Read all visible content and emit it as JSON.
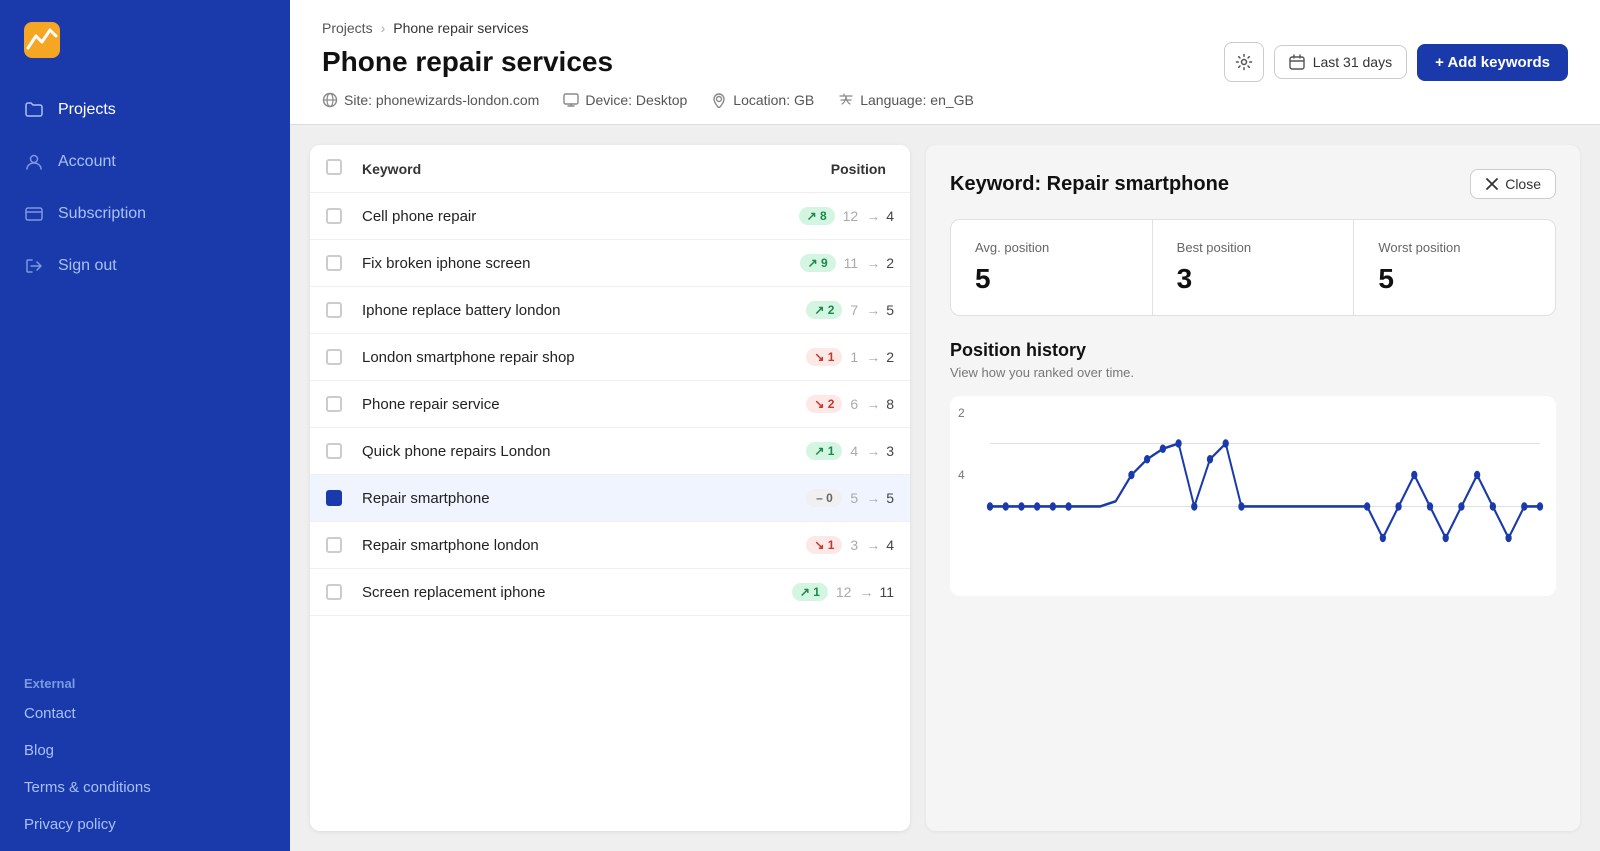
{
  "sidebar": {
    "logo_alt": "Analytics logo",
    "nav_items": [
      {
        "id": "projects",
        "label": "Projects",
        "active": false
      },
      {
        "id": "account",
        "label": "Account",
        "active": false
      },
      {
        "id": "subscription",
        "label": "Subscription",
        "active": false
      },
      {
        "id": "signout",
        "label": "Sign out",
        "active": false
      }
    ],
    "external_label": "External",
    "external_links": [
      {
        "id": "contact",
        "label": "Contact"
      },
      {
        "id": "blog",
        "label": "Blog"
      },
      {
        "id": "terms",
        "label": "Terms & conditions"
      },
      {
        "id": "privacy",
        "label": "Privacy policy"
      }
    ]
  },
  "header": {
    "breadcrumb_projects": "Projects",
    "breadcrumb_current": "Phone repair services",
    "title": "Phone repair services",
    "meta": {
      "site": "Site: phonewizards-london.com",
      "device": "Device: Desktop",
      "location": "Location: GB",
      "language": "Language: en_GB"
    },
    "btn_date": "Last 31 days",
    "btn_add_keywords": "+ Add keywords"
  },
  "table": {
    "col_keyword": "Keyword",
    "col_position": "Position",
    "rows": [
      {
        "keyword": "Cell phone repair",
        "badge": "8",
        "badge_type": "up",
        "from": "12",
        "to": "4"
      },
      {
        "keyword": "Fix broken iphone screen",
        "badge": "9",
        "badge_type": "up",
        "from": "11",
        "to": "2"
      },
      {
        "keyword": "Iphone replace battery london",
        "badge": "2",
        "badge_type": "up",
        "from": "7",
        "to": "5"
      },
      {
        "keyword": "London smartphone repair shop",
        "badge": "1",
        "badge_type": "down",
        "from": "1",
        "to": "2"
      },
      {
        "keyword": "Phone repair service",
        "badge": "2",
        "badge_type": "down",
        "from": "6",
        "to": "8"
      },
      {
        "keyword": "Quick phone repairs London",
        "badge": "1",
        "badge_type": "up",
        "from": "4",
        "to": "3"
      },
      {
        "keyword": "Repair smartphone",
        "badge": "0",
        "badge_type": "neutral",
        "from": "5",
        "to": "5",
        "selected": true
      },
      {
        "keyword": "Repair smartphone london",
        "badge": "1",
        "badge_type": "down",
        "from": "3",
        "to": "4"
      },
      {
        "keyword": "Screen replacement iphone",
        "badge": "1",
        "badge_type": "up",
        "from": "12",
        "to": "11"
      }
    ]
  },
  "detail": {
    "title": "Keyword: Repair smartphone",
    "btn_close": "Close",
    "stats": {
      "avg_label": "Avg. position",
      "avg_value": "5",
      "best_label": "Best position",
      "best_value": "3",
      "worst_label": "Worst position",
      "worst_value": "5"
    },
    "history_title": "Position history",
    "history_sub": "View how you ranked over time.",
    "chart": {
      "y_label_top": "2",
      "y_label_bottom": "4",
      "color": "#1a3aab"
    }
  }
}
